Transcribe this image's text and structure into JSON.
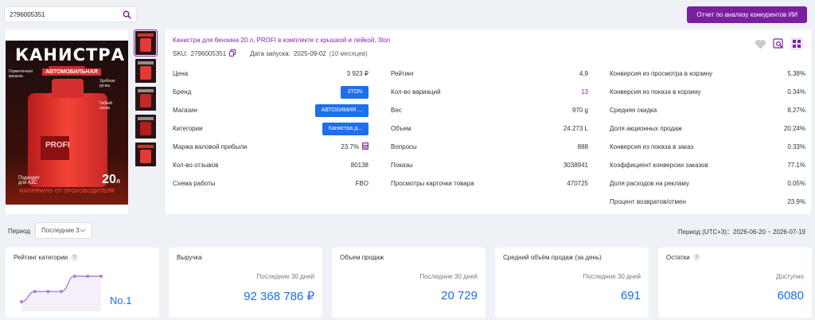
{
  "search": {
    "value": "2796005351"
  },
  "report_button": "Отчет по анализу конкурентов ИИ",
  "image": {
    "headline": "КАНИСТРА",
    "badge": "АВТОМОБИЛЬНАЯ",
    "note_left": "Герметичная крышка",
    "note_right": "Удобная ручка",
    "note_right2": "Гибкий носик",
    "can_brand": "PROFI",
    "bottom_left": "Подходит для АЗС",
    "volume": "20",
    "volume_unit": "л",
    "banner": "НАПРЯМУЮ ОТ ПРОИЗВОДИТЕЛЯ"
  },
  "product": {
    "title": "Канистра для бензина 20 л, PROFI в комплекте с крышкой и лейкой, 3ton",
    "sku_label": "SKU:",
    "sku": "2796005351",
    "launch_label": "Дата запуска:",
    "launch_date": "2025-09-02",
    "launch_age": "(10 месяцев)"
  },
  "col1": [
    {
      "label": "Цена",
      "value": "3 923 ₽"
    },
    {
      "label": "Бренд",
      "chip": "3TON"
    },
    {
      "label": "Магазин",
      "chip": "АВТОХИМИЯ ..."
    },
    {
      "label": "Категории",
      "chip": "Канистра д..."
    },
    {
      "label": "Маржа валовой прибыли",
      "value": "23.7%"
    },
    {
      "label": "Кол-во отзывов",
      "value": "80138"
    },
    {
      "label": "Схема работы",
      "value": "FBO"
    }
  ],
  "col2": [
    {
      "label": "Рейтинг",
      "value": "4.9"
    },
    {
      "label": "Кол-во вариаций",
      "value": "13"
    },
    {
      "label": "Вес",
      "value": "970 g"
    },
    {
      "label": "Объем",
      "value": "24.273 L"
    },
    {
      "label": "Вопросы",
      "value": "888"
    },
    {
      "label": "Показы",
      "value": "3038941"
    },
    {
      "label": "Просмотры карточки товара",
      "value": "470725"
    }
  ],
  "col3": [
    {
      "label": "Конверсия из просмотра в корзину",
      "value": "5.38%"
    },
    {
      "label": "Конверсия из показа в корзину",
      "value": "0.34%"
    },
    {
      "label": "Средняя скидка",
      "value": "8.27%"
    },
    {
      "label": "Доля акционных продаж",
      "value": "20.24%"
    },
    {
      "label": "Конверсия из показа в заказ",
      "value": "0.33%"
    },
    {
      "label": "Коэффициент конверсии заказов",
      "value": "77.1%"
    },
    {
      "label": "Доля расходов на рекламу",
      "value": "0.05%"
    },
    {
      "label": "Процент возвратов/отмен",
      "value": "23.9%"
    }
  ],
  "period": {
    "label": "Период",
    "select_value": "Последние 3",
    "range_label": "Период (UTC+3)：",
    "range": "2026-06-20 ~ 2026-07-19"
  },
  "stats": {
    "rating": {
      "title": "Рейтинг категории",
      "rank": "No.1",
      "trend": [
        6,
        4,
        4,
        4,
        1,
        1,
        1
      ]
    },
    "revenue": {
      "title": "Выручка",
      "sub": "Последние 30 дней",
      "value": "92 368 786 ₽"
    },
    "volume": {
      "title": "Объем продаж",
      "sub": "Последние 30 дней",
      "value": "20 729"
    },
    "avg_volume": {
      "title": "Средний объём продаж (за день)",
      "sub": "Последние 30 дней",
      "value": "691"
    },
    "stock": {
      "title": "Остатки",
      "sub": "Доступно",
      "value": "6080"
    }
  },
  "colors": {
    "accent": "#7b1fa2",
    "link": "#8e24aa",
    "blue": "#1e6fe8",
    "trend": "#b07cd6"
  }
}
